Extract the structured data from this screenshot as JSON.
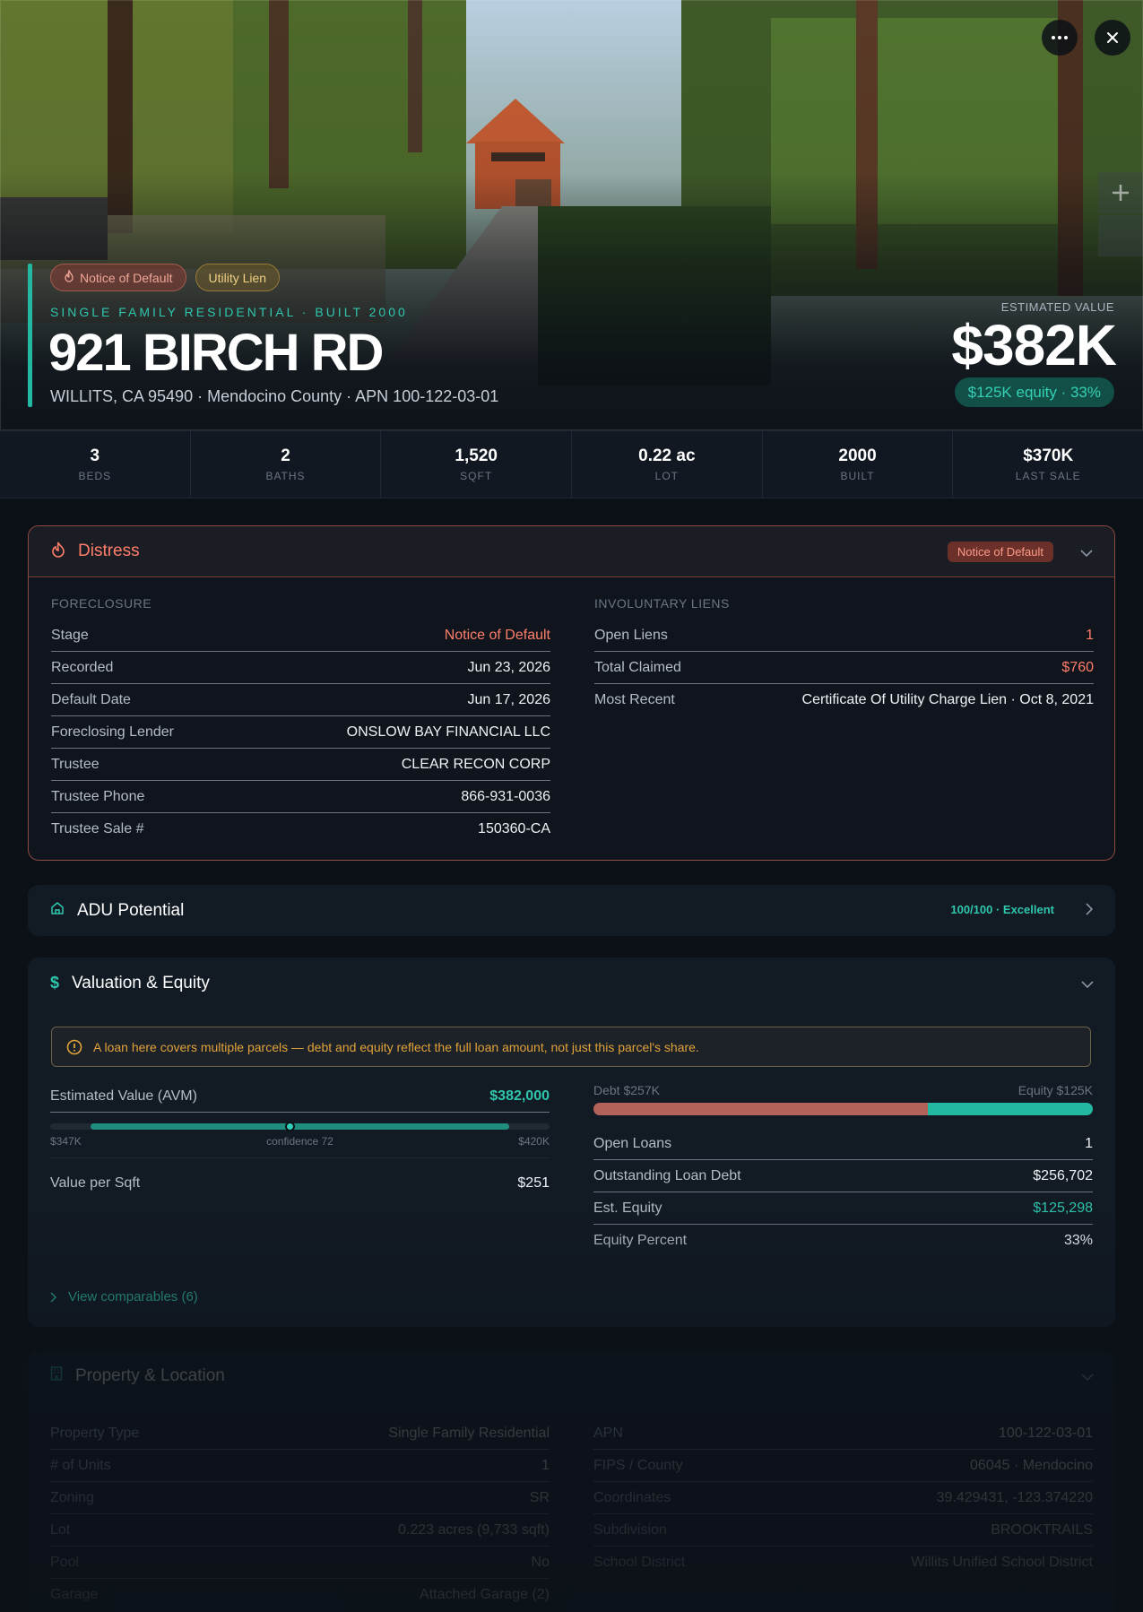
{
  "hero": {
    "badges": [
      "Notice of Default",
      "Utility Lien"
    ],
    "property_type": "SINGLE FAMILY RESIDENTIAL · BUILT 2000",
    "address": "921 BIRCH RD",
    "subline": "WILLITS, CA 95490 · Mendocino County · APN 100-122-03-01",
    "est_label": "ESTIMATED VALUE",
    "est_value": "$382K",
    "equity_pill": "$125K equity · 33%"
  },
  "stats": [
    {
      "value": "3",
      "label": "BEDS"
    },
    {
      "value": "2",
      "label": "BATHS"
    },
    {
      "value": "1,520",
      "label": "SQFT"
    },
    {
      "value": "0.22 ac",
      "label": "LOT"
    },
    {
      "value": "2000",
      "label": "BUILT"
    },
    {
      "value": "$370K",
      "label": "LAST SALE"
    }
  ],
  "distress": {
    "title": "Distress",
    "badge": "Notice of Default",
    "foreclosure_head": "FORECLOSURE",
    "foreclosure": [
      {
        "k": "Stage",
        "v": "Notice of Default"
      },
      {
        "k": "Recorded",
        "v": "Jun 23, 2026"
      },
      {
        "k": "Default Date",
        "v": "Jun 17, 2026"
      },
      {
        "k": "Foreclosing Lender",
        "v": "ONSLOW BAY FINANCIAL LLC"
      },
      {
        "k": "Trustee",
        "v": "CLEAR RECON CORP"
      },
      {
        "k": "Trustee Phone",
        "v": "866-931-0036"
      },
      {
        "k": "Trustee Sale #",
        "v": "150360-CA"
      }
    ],
    "liens_head": "INVOLUNTARY LIENS",
    "liens": [
      {
        "k": "Open Liens",
        "v": "1"
      },
      {
        "k": "Total Claimed",
        "v": "$760"
      },
      {
        "k": "Most Recent",
        "v": "Certificate Of Utility Charge Lien · Oct 8, 2021"
      }
    ]
  },
  "adu": {
    "title": "ADU Potential",
    "badge": "100/100 · Excellent"
  },
  "valuation": {
    "title": "Valuation & Equity",
    "warning": "A loan here covers multiple parcels — debt and equity reflect the full loan amount, not just this parcel's share.",
    "avm_label": "Estimated Value (AVM)",
    "avm_value": "$382,000",
    "avm_low": "$347K",
    "avm_confidence": "confidence 72",
    "avm_high": "$420K",
    "avm_position": 0.48,
    "value_sqft_label": "Value per Sqft",
    "value_sqft": "$251",
    "debt_label": "Debt $257K",
    "equity_label": "Equity $125K",
    "debt_fraction": 0.67,
    "loans": [
      {
        "k": "Open Loans",
        "v": "1"
      },
      {
        "k": "Outstanding Loan Debt",
        "v": "$256,702"
      },
      {
        "k": "Est. Equity",
        "v": "$125,298"
      },
      {
        "k": "Equity Percent",
        "v": "33%"
      }
    ],
    "comparables": "View comparables (6)"
  },
  "property": {
    "title": "Property & Location",
    "left": [
      {
        "k": "Property Type",
        "v": "Single Family Residential"
      },
      {
        "k": "# of Units",
        "v": "1"
      },
      {
        "k": "Zoning",
        "v": "SR"
      },
      {
        "k": "Lot",
        "v": "0.223 acres (9,733 sqft)"
      },
      {
        "k": "Pool",
        "v": "No"
      },
      {
        "k": "Garage",
        "v": "Attached Garage (2)"
      }
    ],
    "right": [
      {
        "k": "APN",
        "v": "100-122-03-01"
      },
      {
        "k": "FIPS / County",
        "v": "06045 · Mendocino"
      },
      {
        "k": "Coordinates",
        "v": "39.429431, -123.374220"
      },
      {
        "k": "Subdivision",
        "v": "BROOKTRAILS"
      },
      {
        "k": "School District",
        "v": "Willits Unified School District"
      }
    ]
  },
  "colors": {
    "accent": "#22b8a2",
    "danger": "#ff7e6a",
    "warning": "#e0a33a",
    "debt": "#b3625a",
    "equity": "#22b8a2"
  }
}
